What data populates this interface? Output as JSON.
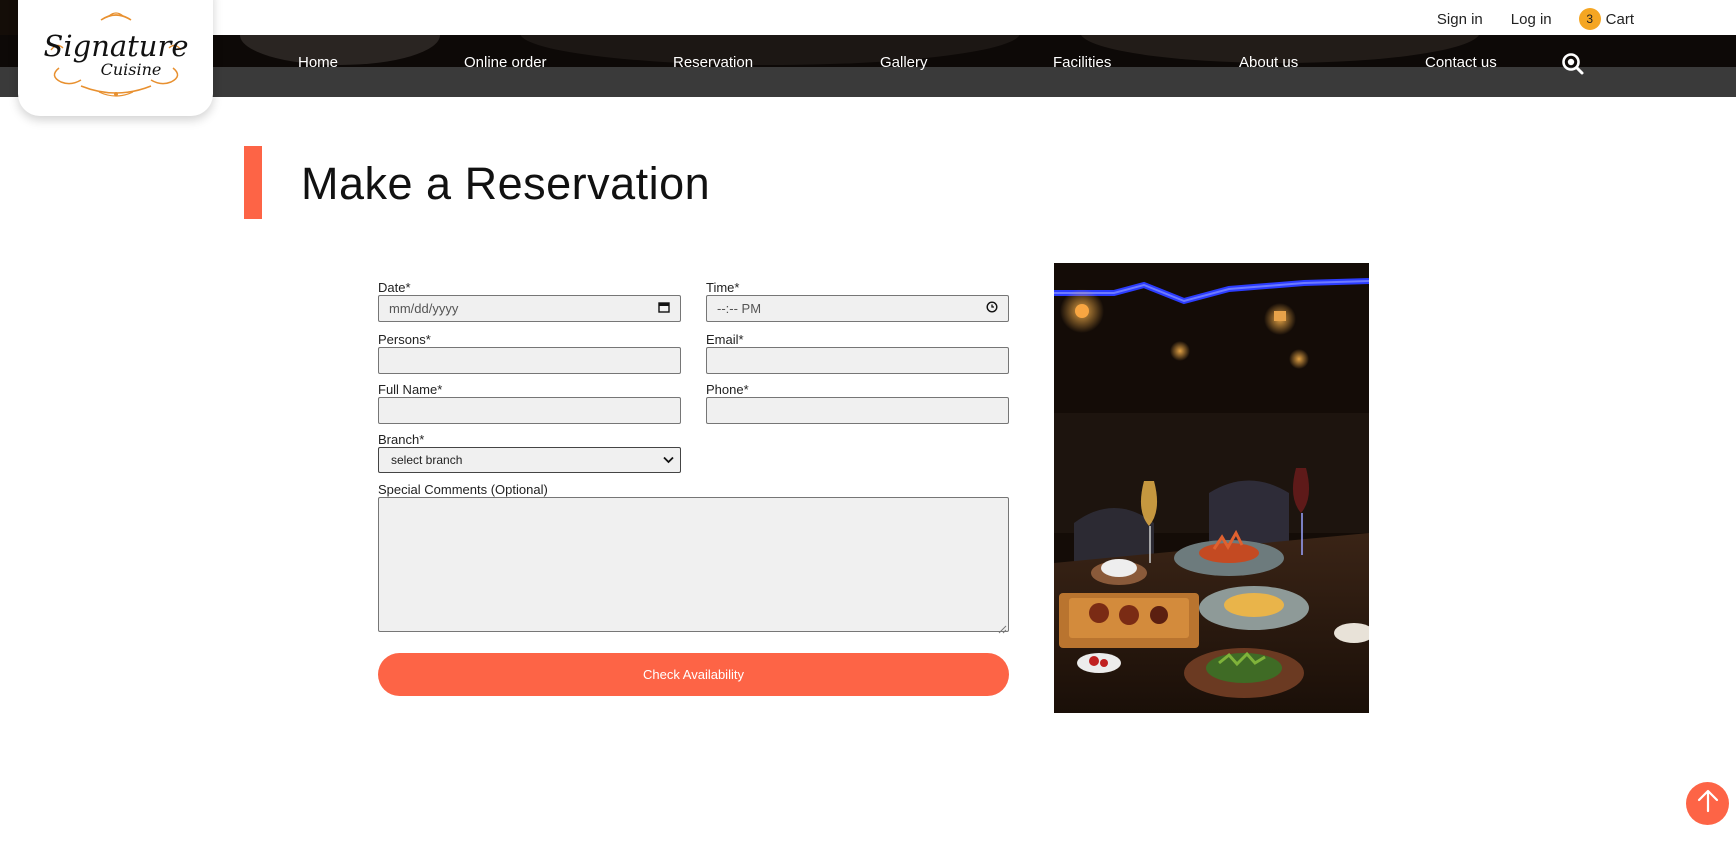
{
  "topbar": {
    "sign_in": "Sign in",
    "log_in": "Log in",
    "cart_count": "3",
    "cart_label": "Cart"
  },
  "logo": {
    "line1": "Signature",
    "line2": "Cuisine"
  },
  "nav": {
    "items": [
      {
        "label": "Home"
      },
      {
        "label": "Online order"
      },
      {
        "label": "Reservation"
      },
      {
        "label": "Gallery"
      },
      {
        "label": "Facilities"
      },
      {
        "label": "About us"
      },
      {
        "label": "Contact us"
      }
    ],
    "search_icon": "search-icon"
  },
  "page": {
    "title": "Make a Reservation"
  },
  "form": {
    "date_label": "Date*",
    "date_placeholder": "mm/dd/yyyy",
    "time_label": "Time*",
    "time_placeholder": "--:-- PM",
    "persons_label": "Persons*",
    "persons_value": "",
    "email_label": "Email*",
    "email_value": "",
    "fullname_label": "Full Name*",
    "fullname_value": "",
    "phone_label": "Phone*",
    "phone_value": "",
    "branch_label": "Branch*",
    "branch_selected": "select branch",
    "comments_label": "Special Comments (Optional)",
    "comments_value": "",
    "submit_label": "Check Availability"
  },
  "colors": {
    "accent": "#fd6446",
    "badge": "#f5a623",
    "nav_bg": "#0d0907"
  },
  "icons": {
    "calendar": "calendar-icon",
    "clock": "clock-icon",
    "chevron": "chevron-down-icon",
    "back_to_top": "arrow-up-icon"
  }
}
